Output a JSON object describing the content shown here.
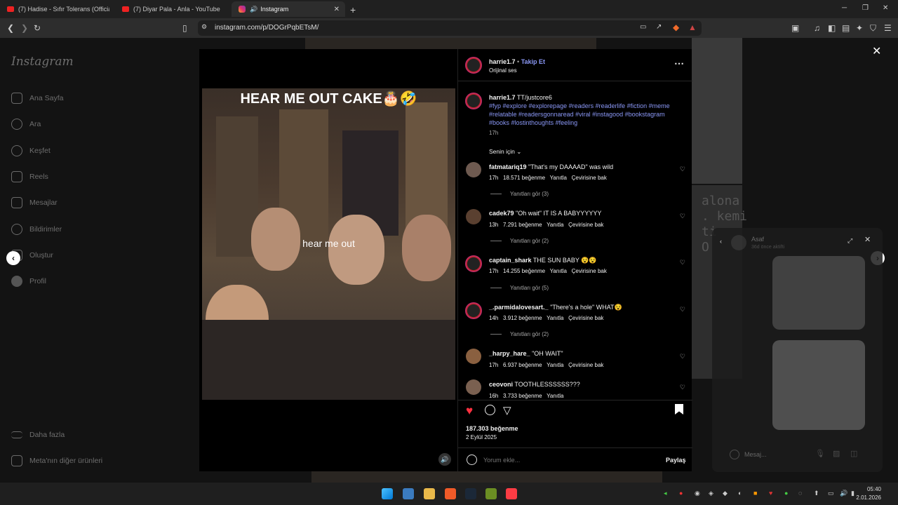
{
  "browser": {
    "tabs": [
      {
        "title": "(7) Hadise - Sıfır Tolerans (Official Vid"
      },
      {
        "title": "(7) Diyar Pala - Anla - YouTube"
      },
      {
        "title": "Instagram"
      }
    ],
    "url": "instagram.com/p/DOGrPqbETsM/"
  },
  "sidebar": {
    "logo": "Instagram",
    "items": [
      {
        "label": "Ana Sayfa"
      },
      {
        "label": "Ara"
      },
      {
        "label": "Keşfet"
      },
      {
        "label": "Reels"
      },
      {
        "label": "Mesajlar"
      },
      {
        "label": "Bildirimler"
      },
      {
        "label": "Oluştur"
      },
      {
        "label": "Profil"
      }
    ],
    "more": "Daha fazla",
    "meta": "Meta'nın diğer ürünleri"
  },
  "video": {
    "title": "HEAR ME OUT CAKE🎂🤣",
    "caption": "hear me out"
  },
  "post": {
    "username": "harrie1.7",
    "follow": "Takip Et",
    "audio": "Orijinal ses",
    "caption_user": "harrie1.7",
    "caption_text": "TT/justcore6",
    "hashtags_1": "#fyp #explore #explorepage #readers #readerlife #fiction #meme",
    "hashtags_2": "#relatable #readersgonnaread #viral #instagood #bookstagram",
    "hashtags_3": "#books #lostinthoughts #feeling",
    "time": "17h",
    "sort": "Senin için",
    "likes": "187.303 beğenme",
    "date": "2 Eylül 2025",
    "add_comment_placeholder": "Yorum ekle...",
    "share": "Paylaş"
  },
  "comments": [
    {
      "user": "fatmatariq19",
      "text": "\"That's my DAAAAD\" was wild",
      "time": "17h",
      "likes": "18.571 beğenme",
      "reply": "Yanıtla",
      "translate": "Çevirisine bak",
      "replies": "Yanıtları gör (3)"
    },
    {
      "user": "cadek79",
      "text": "\"Oh wait\" IT IS A BABYYYYYY",
      "time": "13h",
      "likes": "7.291 beğenme",
      "reply": "Yanıtla",
      "translate": "Çevirisine bak",
      "replies": "Yanıtları gör (2)"
    },
    {
      "user": "captain_shark",
      "text": "THE SUN BABY 😵😵",
      "time": "17h",
      "likes": "14.255 beğenme",
      "reply": "Yanıtla",
      "translate": "Çevirisine bak",
      "replies": "Yanıtları gör (5)"
    },
    {
      "user": "_.parmidalovesart._",
      "text": "\"There's a hole\" WHAT😵",
      "time": "14h",
      "likes": "3.912 beğenme",
      "reply": "Yanıtla",
      "translate": "Çevirisine bak",
      "replies": "Yanıtları gör (2)"
    },
    {
      "user": "_harpy_hare_",
      "text": "\"OH WAIT\"",
      "time": "17h",
      "likes": "6.937 beğenme",
      "reply": "Yanıtla",
      "translate": "Çevirisine bak",
      "replies": ""
    },
    {
      "user": "ceovoni",
      "text": "TOOTHLESSSSSS???",
      "time": "16h",
      "likes": "3.733 beğenme",
      "reply": "Yanıtla",
      "translate": "",
      "replies": ""
    }
  ],
  "messages_popup": {
    "name": "Asaf",
    "status": "36d önce aktifti",
    "placeholder": "Mesaj..."
  },
  "background_text": [
    "alona",
    ". kemi",
    "ti",
    "O"
  ],
  "taskbar": {
    "time": "05:40",
    "date": "2.01.2026"
  },
  "colors": {
    "accent_link": "#8a97f5",
    "like_red": "#ff3040"
  }
}
